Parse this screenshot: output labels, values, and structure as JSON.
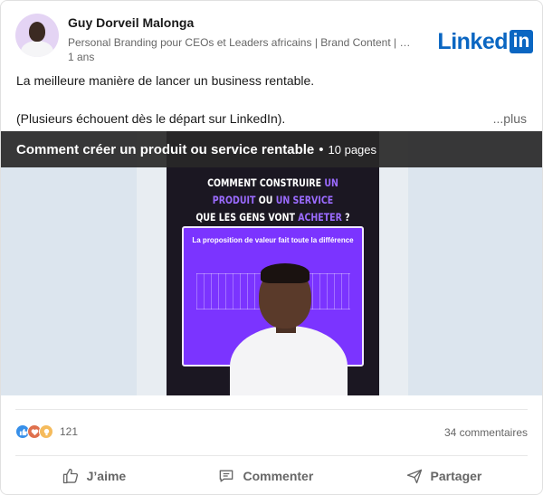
{
  "post": {
    "author": "Guy Dorveil Malonga",
    "headline": "Personal Branding pour CEOs et Leaders africains | Brand Content | Dével...",
    "timestamp": "1 ans",
    "brand": {
      "word": "Linked",
      "box": "in"
    },
    "text_line1": "La meilleure manière de lancer un business rentable.",
    "text_line2": "(Plusieurs échouent dès le départ sur LinkedIn).",
    "more_label": "...plus"
  },
  "document": {
    "title": "Comment créer un produit ou service rentable",
    "separator": "•",
    "pages": "10 pages",
    "slide": {
      "line1_a": "COMMENT CONSTRUIRE",
      "line1_b": "UN PRODUIT",
      "line1_c": "OU",
      "line1_d": "UN SERVICE",
      "line2_a": "QUE LES GENS VONT",
      "line2_b": "ACHETER",
      "line2_c": "?",
      "box_caption": "La proposition de valeur fait toute la différence"
    }
  },
  "social": {
    "reaction_count": "121",
    "comments": "34 commentaires"
  },
  "actions": {
    "like": "J’aime",
    "comment": "Commenter",
    "share": "Partager"
  },
  "colors": {
    "accent": "#0a66c2",
    "slide_purple": "#7b34ff",
    "slide_bg": "#1b1722"
  }
}
